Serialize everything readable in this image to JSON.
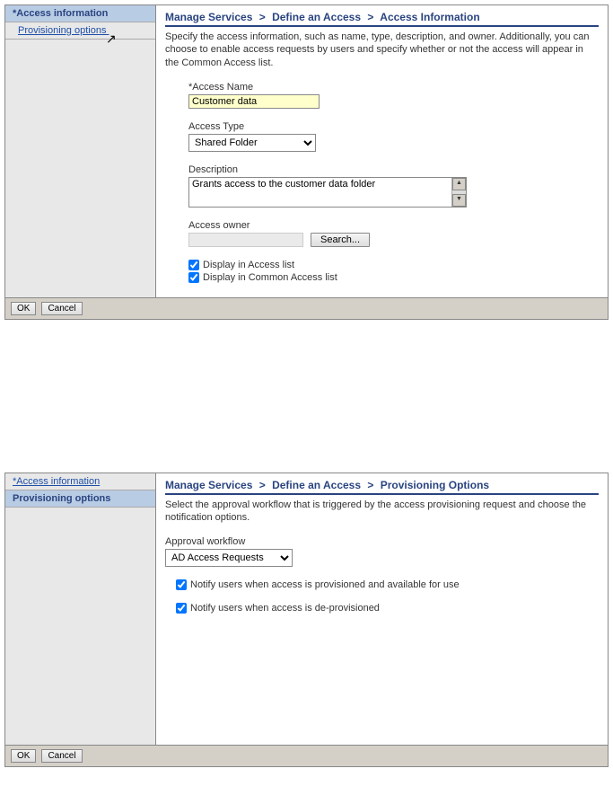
{
  "panel1": {
    "sidebar": {
      "items": [
        {
          "label": "*Access information",
          "active": true
        },
        {
          "label": "Provisioning options",
          "active": false
        }
      ]
    },
    "breadcrumb": {
      "parts": [
        "Manage Services",
        "Define an Access",
        "Access Information"
      ]
    },
    "description": "Specify the access information, such as name, type, description, and owner. Additionally, you can choose to enable access requests by users and specify whether or not the access will appear in the Common Access list.",
    "fields": {
      "accessName": {
        "label": "*Access Name",
        "value": "Customer data"
      },
      "accessType": {
        "label": "Access Type",
        "value": "Shared Folder",
        "options": [
          "Shared Folder"
        ]
      },
      "descField": {
        "label": "Description",
        "value": "Grants access to the customer data folder"
      },
      "owner": {
        "label": "Access owner",
        "value": "",
        "searchLabel": "Search..."
      },
      "displayAccessList": {
        "label": "Display in Access list",
        "checked": true
      },
      "displayCommonList": {
        "label": "Display in Common Access list",
        "checked": true
      }
    },
    "footer": {
      "ok": "OK",
      "cancel": "Cancel"
    }
  },
  "panel2": {
    "sidebar": {
      "items": [
        {
          "label": "*Access information",
          "active": false
        },
        {
          "label": "Provisioning options",
          "active": true
        }
      ]
    },
    "breadcrumb": {
      "parts": [
        "Manage Services",
        "Define an Access",
        "Provisioning Options"
      ]
    },
    "description": "Select the approval workflow that is triggered by the access provisioning request and choose the notification options.",
    "fields": {
      "approvalWorkflow": {
        "label": "Approval workflow",
        "value": "AD Access Requests",
        "options": [
          "AD Access Requests"
        ]
      },
      "notifyProvisioned": {
        "label": "Notify users when access is provisioned and available for use",
        "checked": true
      },
      "notifyDeprovisioned": {
        "label": "Notify users when access is de-provisioned",
        "checked": true
      }
    },
    "footer": {
      "ok": "OK",
      "cancel": "Cancel"
    }
  }
}
